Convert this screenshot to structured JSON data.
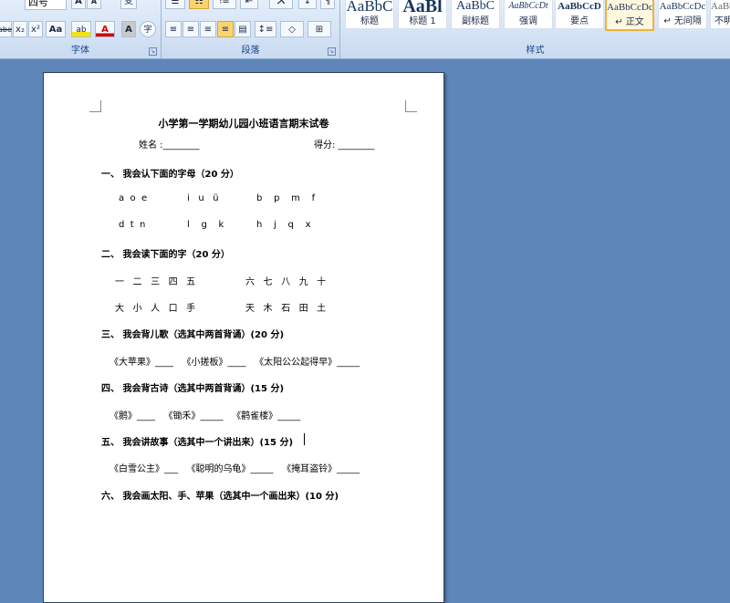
{
  "ribbon": {
    "font_group": {
      "label": "字体",
      "font_size": "四号",
      "grow_label": "A",
      "shrink_label": "A",
      "clear_label": "变",
      "strike_label": "abe",
      "sub_label": "x₂",
      "sup_label": "x²",
      "case_label": "Aa",
      "highlight_label": "ab",
      "color_label": "A",
      "shade_label": "A",
      "enclose_label": "字"
    },
    "paragraph_group": {
      "label": "段落"
    },
    "styles_group": {
      "label": "样式",
      "items": [
        {
          "sample": "AaBbC",
          "name": "标题"
        },
        {
          "sample": "AaBl",
          "name": "标题 1"
        },
        {
          "sample": "AaBbC",
          "name": "副标题"
        },
        {
          "sample": "AaBbCcDt",
          "name": "强调"
        },
        {
          "sample": "AaBbCcD",
          "name": "要点"
        },
        {
          "sample": "AaBbCcDc",
          "name": "↵ 正文"
        },
        {
          "sample": "AaBbCcDc",
          "name": "↵ 无间隔"
        },
        {
          "sample": "AaBbCc",
          "name": "不明"
        }
      ]
    }
  },
  "document": {
    "title": "小学第一学期幼儿园小班语言期末试卷",
    "name_field": "姓名 :________",
    "score_field": "得分: ________",
    "sections": [
      {
        "heading": "一、 我会认下面的字母（20 分）",
        "rows": [
          [
            "a  o  e",
            "i   u   ü",
            "b    p    m    f"
          ],
          [
            "d  t  n",
            "l    g    k",
            "h    j    q    x"
          ]
        ]
      },
      {
        "heading": "二、 我会读下面的字（20 分）",
        "rows": [
          [
            "一   二   三   四   五",
            "六   七   八   九   十"
          ],
          [
            "大   小   人   口   手",
            "天   木   石   田   土"
          ]
        ]
      },
      {
        "heading": "三、 我会背儿歌（选其中两首背诵）(20 分)",
        "line": "《大苹果》____   《小搓板》____   《太阳公公起得早》_____"
      },
      {
        "heading": "四、 我会背古诗（选其中两首背诵）(15 分)",
        "line": "《鹅》____   《锄禾》_____   《鹳雀楼》_____"
      },
      {
        "heading": "五、 我会讲故事（选其中一个讲出来）(15 分)",
        "line": "《白雪公主》___   《聪明的乌龟》_____   《掩耳盗铃》_____"
      },
      {
        "heading": "六、 我会画太阳、手、苹果（选其中一个画出来）(10 分)"
      }
    ]
  }
}
